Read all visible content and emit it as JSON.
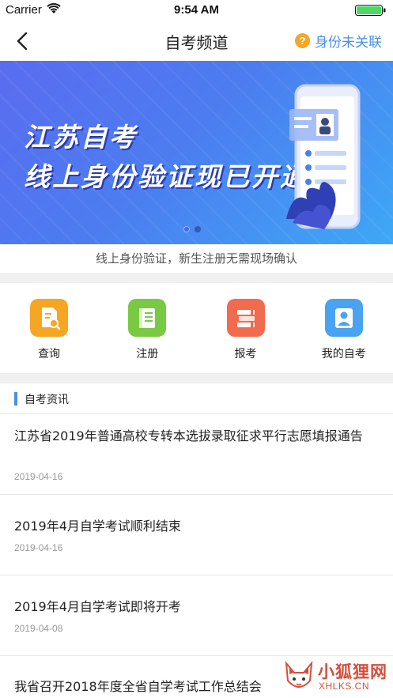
{
  "status_bar": {
    "carrier": "Carrier",
    "time": "9:54 AM"
  },
  "nav": {
    "title": "自考频道",
    "right_label": "身份未关联",
    "help_glyph": "?",
    "icons": {
      "back": "back-chevron-icon",
      "help": "help-circle-icon"
    },
    "accent_color": "#4a90e2",
    "help_color": "#f5a623"
  },
  "banner": {
    "title_line1": "江苏自考",
    "title_line2": "线上身份验证现已开通",
    "caption": "线上身份验证，新生注册无需现场确认",
    "slide_count": 2,
    "active_slide": 1
  },
  "quick_menu": {
    "items": [
      {
        "label": "查询",
        "icon": "search-doc-icon",
        "color": "#f5a623"
      },
      {
        "label": "注册",
        "icon": "register-book-icon",
        "color": "#7ac943"
      },
      {
        "label": "报考",
        "icon": "books-stack-icon",
        "color": "#f26b4f"
      },
      {
        "label": "我的自考",
        "icon": "user-profile-icon",
        "color": "#4aa3f0"
      }
    ]
  },
  "news": {
    "section_title": "自考资讯",
    "items": [
      {
        "title": "江苏省2019年普通高校专转本选拔录取征求平行志愿填报通告",
        "date": "2019-04-16"
      },
      {
        "title": "2019年4月自学考试顺利结束",
        "date": "2019-04-16"
      },
      {
        "title": "2019年4月自学考试即将开考",
        "date": "2019-04-08"
      },
      {
        "title": "我省召开2018年度全省自学考试工作总结会",
        "date": ""
      }
    ]
  },
  "watermark": {
    "name": "小狐狸网",
    "domain": "XHLKS.CN"
  }
}
